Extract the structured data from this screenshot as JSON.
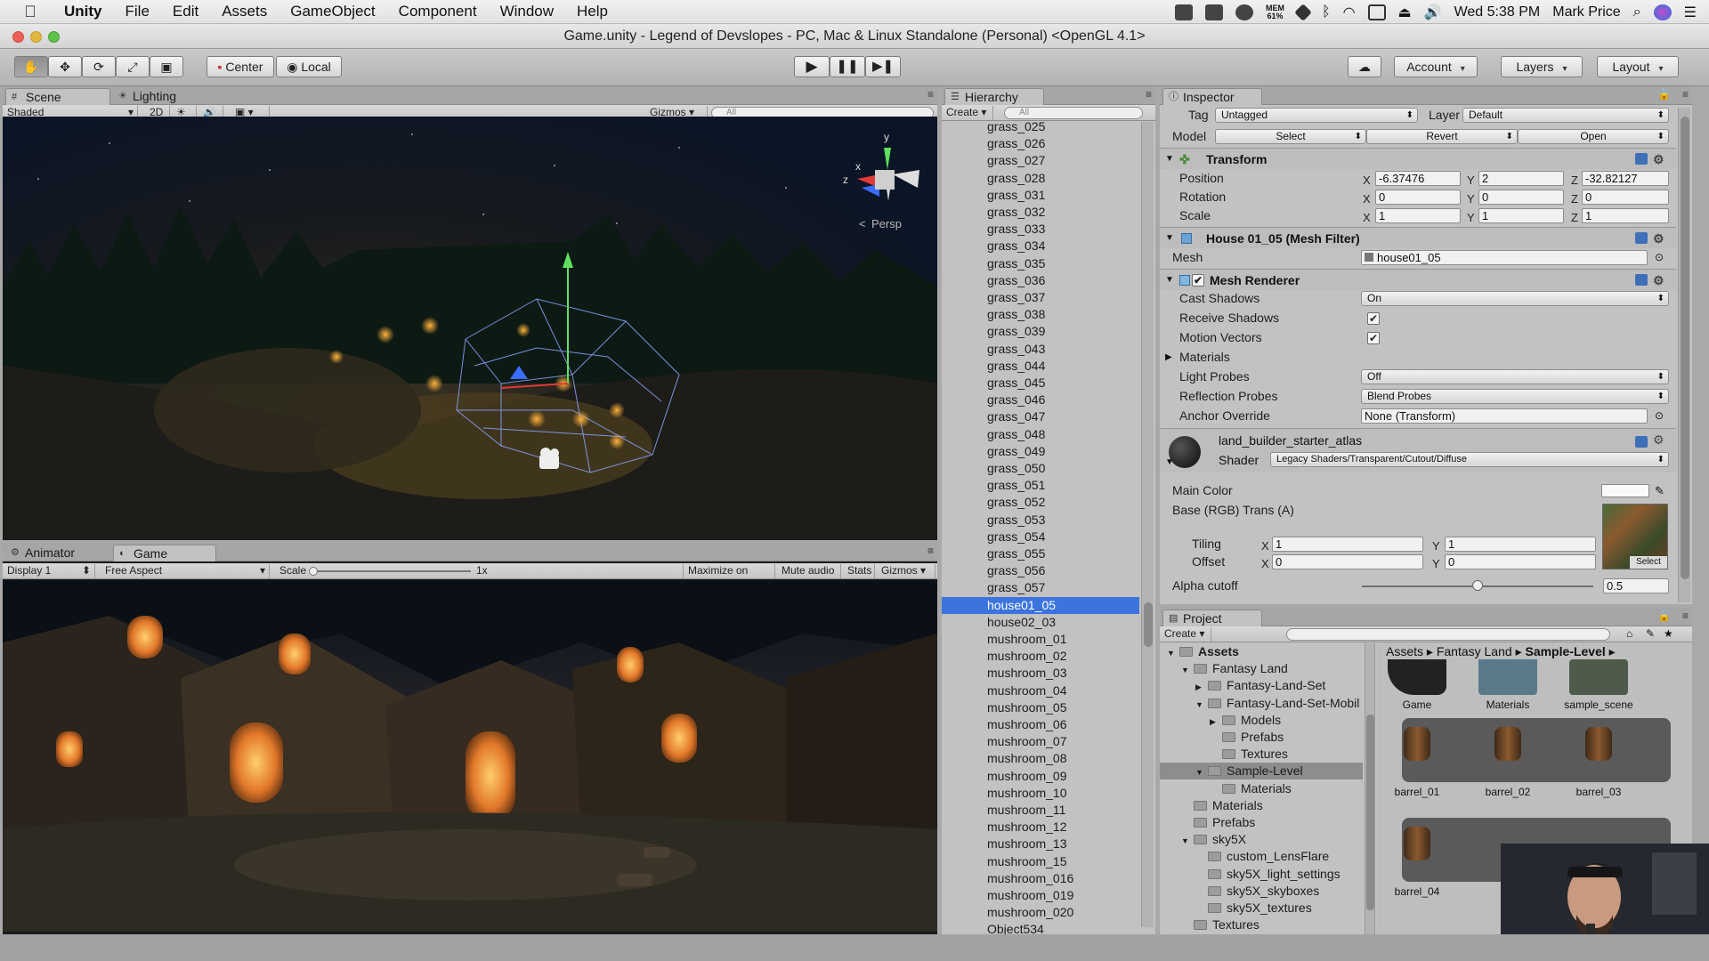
{
  "menubar": {
    "app": "Unity",
    "items": [
      "File",
      "Edit",
      "Assets",
      "GameObject",
      "Component",
      "Window",
      "Help"
    ],
    "mem_label": "MEM",
    "mem_value": "61%",
    "clock": "Wed 5:38 PM",
    "user": "Mark Price"
  },
  "titlebar": {
    "title": "Game.unity - Legend of Devslopes - PC, Mac & Linux Standalone (Personal) <OpenGL 4.1>"
  },
  "toolbar": {
    "center": "Center",
    "local": "Local",
    "account": "Account",
    "layers": "Layers",
    "layout": "Layout"
  },
  "scene": {
    "tabs": [
      "Scene",
      "Lighting"
    ],
    "shading": "Shaded",
    "mode2d": "2D",
    "gizmos": "Gizmos",
    "search_placeholder": "All",
    "persp": "Persp",
    "gizmo_y": "y",
    "gizmo_x": "x",
    "gizmo_z": "z"
  },
  "game": {
    "tabs": [
      "Animator",
      "Game"
    ],
    "display": "Display 1",
    "aspect": "Free Aspect",
    "scale_label": "Scale",
    "scale_value": "1x",
    "maximize": "Maximize on Play",
    "mute": "Mute audio",
    "stats": "Stats",
    "gizmos": "Gizmos"
  },
  "hierarchy": {
    "tab": "Hierarchy",
    "create": "Create",
    "search_placeholder": "All",
    "rows": [
      "grass_025",
      "grass_026",
      "grass_027",
      "grass_028",
      "grass_031",
      "grass_032",
      "grass_033",
      "grass_034",
      "grass_035",
      "grass_036",
      "grass_037",
      "grass_038",
      "grass_039",
      "grass_043",
      "grass_044",
      "grass_045",
      "grass_046",
      "grass_047",
      "grass_048",
      "grass_049",
      "grass_050",
      "grass_051",
      "grass_052",
      "grass_053",
      "grass_054",
      "grass_055",
      "grass_056",
      "grass_057",
      "house01_05",
      "house02_03",
      "mushroom_01",
      "mushroom_02",
      "mushroom_03",
      "mushroom_04",
      "mushroom_05",
      "mushroom_06",
      "mushroom_07",
      "mushroom_08",
      "mushroom_09",
      "mushroom_10",
      "mushroom_11",
      "mushroom_12",
      "mushroom_13",
      "mushroom_15",
      "mushroom_016",
      "mushroom_019",
      "mushroom_020",
      "Object534"
    ],
    "selected": "house01_05"
  },
  "inspector": {
    "tab": "Inspector",
    "tag_label": "Tag",
    "tag_value": "Untagged",
    "layer_label": "Layer",
    "layer_value": "Default",
    "model_label": "Model",
    "model_select": "Select",
    "model_revert": "Revert",
    "model_open": "Open",
    "transform": {
      "title": "Transform",
      "position_label": "Position",
      "rotation_label": "Rotation",
      "scale_label": "Scale",
      "position": {
        "x": "-6.37476",
        "y": "2",
        "z": "-32.82127"
      },
      "rotation": {
        "x": "0",
        "y": "0",
        "z": "0"
      },
      "scale": {
        "x": "1",
        "y": "1",
        "z": "1"
      }
    },
    "mesh_filter": {
      "title": "House 01_05 (Mesh Filter)",
      "mesh_label": "Mesh",
      "mesh_value": "house01_05"
    },
    "mesh_renderer": {
      "title": "Mesh Renderer",
      "cast_shadows_label": "Cast Shadows",
      "cast_shadows": "On",
      "receive_shadows_label": "Receive Shadows",
      "receive_shadows": true,
      "motion_vectors_label": "Motion Vectors",
      "motion_vectors": true,
      "materials_label": "Materials",
      "light_probes_label": "Light Probes",
      "light_probes": "Off",
      "reflection_probes_label": "Reflection Probes",
      "reflection_probes": "Blend Probes",
      "anchor_override_label": "Anchor Override",
      "anchor_override": "None (Transform)"
    },
    "material": {
      "name": "land_builder_starter_atlas",
      "shader_label": "Shader",
      "shader": "Legacy Shaders/Transparent/Cutout/Diffuse",
      "main_color_label": "Main Color",
      "base_label": "Base (RGB) Trans (A)",
      "tiling_label": "Tiling",
      "offset_label": "Offset",
      "tiling": {
        "x": "1",
        "y": "1"
      },
      "offset": {
        "x": "0",
        "y": "0"
      },
      "select": "Select",
      "alpha_cutoff_label": "Alpha cutoff",
      "alpha_cutoff": "0.5",
      "alpha_cutoff_fraction": 0.5
    },
    "axis": {
      "x": "X",
      "y": "Y",
      "z": "Z"
    }
  },
  "project": {
    "tab": "Project",
    "create": "Create",
    "breadcrumb": [
      "Assets",
      "Fantasy Land",
      "Sample-Level"
    ],
    "tree": [
      {
        "label": "Assets",
        "indent": 0,
        "arrow": "▼",
        "bold": true
      },
      {
        "label": "Fantasy Land",
        "indent": 1,
        "arrow": "▼"
      },
      {
        "label": "Fantasy-Land-Set",
        "indent": 2,
        "arrow": "▶"
      },
      {
        "label": "Fantasy-Land-Set-Mobil",
        "indent": 2,
        "arrow": "▼"
      },
      {
        "label": "Models",
        "indent": 3,
        "arrow": "▶"
      },
      {
        "label": "Prefabs",
        "indent": 3,
        "arrow": ""
      },
      {
        "label": "Textures",
        "indent": 3,
        "arrow": ""
      },
      {
        "label": "Sample-Level",
        "indent": 2,
        "arrow": "▼",
        "selected": true
      },
      {
        "label": "Materials",
        "indent": 3,
        "arrow": ""
      },
      {
        "label": "Materials",
        "indent": 1,
        "arrow": ""
      },
      {
        "label": "Prefabs",
        "indent": 1,
        "arrow": ""
      },
      {
        "label": "sky5X",
        "indent": 1,
        "arrow": "▼"
      },
      {
        "label": "custom_LensFlare",
        "indent": 2,
        "arrow": ""
      },
      {
        "label": "sky5X_light_settings",
        "indent": 2,
        "arrow": ""
      },
      {
        "label": "sky5X_skyboxes",
        "indent": 2,
        "arrow": ""
      },
      {
        "label": "sky5X_textures",
        "indent": 2,
        "arrow": ""
      },
      {
        "label": "Textures",
        "indent": 1,
        "arrow": ""
      }
    ],
    "assets": [
      "Game",
      "Materials",
      "sample_scene",
      "barrel_01",
      "barrel_02",
      "barrel_03",
      "barrel_04"
    ]
  }
}
